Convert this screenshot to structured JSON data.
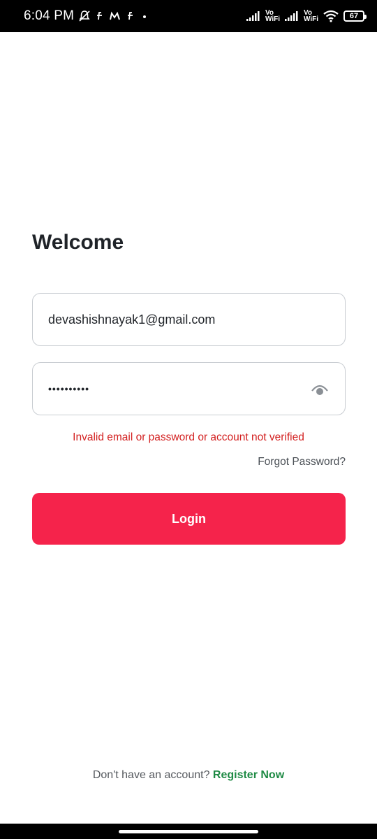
{
  "status_bar": {
    "time": "6:04 PM",
    "battery_level": "67",
    "vowifi_top": "Vo",
    "vowifi_bottom": "WiFi",
    "left_icons": [
      "muted-bell-icon",
      "f-icon",
      "m-icon",
      "f-icon",
      "dot-icon"
    ],
    "right_icons": [
      "signal-icon",
      "vowifi-icon",
      "signal-icon",
      "vowifi-icon",
      "wifi-icon",
      "battery-icon"
    ]
  },
  "login": {
    "title": "Welcome",
    "email_value": "devashishnayak1@gmail.com",
    "password_value": "••••••••••",
    "password_toggle_icon": "eye-icon",
    "error_message": "Invalid email or password or account not verified",
    "forgot_password_label": "Forgot Password?",
    "login_button_label": "Login"
  },
  "footer": {
    "prompt": "Don't have an account?",
    "register_label": "Register Now"
  },
  "colors": {
    "primary_button": "#f5234b",
    "error": "#d32020",
    "link_green": "#1e8a44",
    "title": "#1f2328"
  }
}
